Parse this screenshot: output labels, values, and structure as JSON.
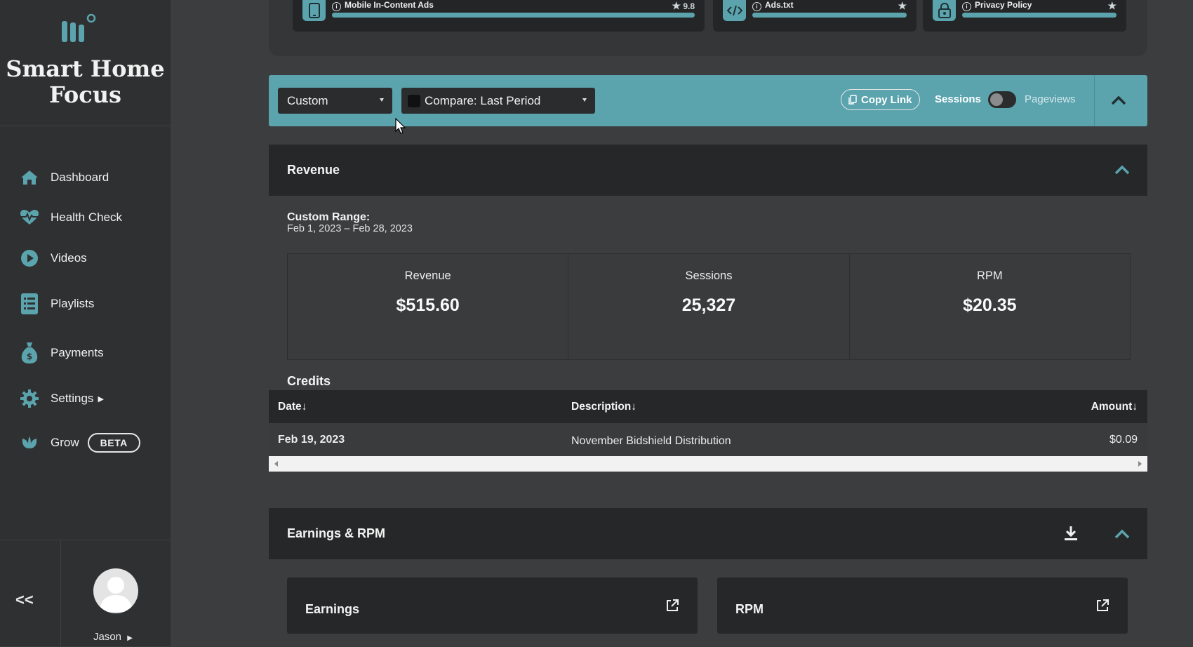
{
  "sidebar": {
    "brand": "Smart Home Focus",
    "items": [
      {
        "label": "Dashboard",
        "icon": "home-icon"
      },
      {
        "label": "Health Check",
        "icon": "heartbeat-icon"
      },
      {
        "label": "Videos",
        "icon": "play-icon"
      },
      {
        "label": "Playlists",
        "icon": "list-icon"
      },
      {
        "label": "Payments",
        "icon": "money-bag-icon"
      },
      {
        "label": "Settings",
        "icon": "gear-icon"
      },
      {
        "label": "Grow",
        "icon": "leaf-icon",
        "badge": "BETA"
      }
    ],
    "collapse_label": "<<",
    "user_name": "Jason"
  },
  "top_cards": [
    {
      "label": "Mobile In-Content Ads",
      "score": "9.8",
      "icon": "tablet-icon"
    },
    {
      "label": "Ads.txt",
      "score": "",
      "icon": "code-icon"
    },
    {
      "label": "Privacy Policy",
      "score": "",
      "icon": "lock-icon"
    }
  ],
  "toolbar": {
    "range_select": "Custom",
    "compare_select": "Compare: Last Period",
    "copy_link": "Copy Link",
    "toggle_left": "Sessions",
    "toggle_right": "Pageviews"
  },
  "revenue": {
    "title": "Revenue",
    "range_label": "Custom Range:",
    "range_value": "Feb 1, 2023 – Feb 28, 2023",
    "stats": [
      {
        "label": "Revenue",
        "value": "$515.60"
      },
      {
        "label": "Sessions",
        "value": "25,327"
      },
      {
        "label": "RPM",
        "value": "$20.35"
      }
    ]
  },
  "credits": {
    "title": "Credits",
    "columns": {
      "date": "Date↓",
      "description": "Description↓",
      "amount": "Amount↓"
    },
    "rows": [
      {
        "date": "Feb 19, 2023",
        "description": "November Bidshield Distribution",
        "amount": "$0.09"
      }
    ]
  },
  "earnings": {
    "title": "Earnings & RPM",
    "cards": [
      {
        "title": "Earnings"
      },
      {
        "title": "RPM"
      }
    ]
  },
  "colors": {
    "accent": "#5ba4ae",
    "sidebar": "#2f3031",
    "panel": "#262728",
    "background": "#3c3d3f"
  }
}
